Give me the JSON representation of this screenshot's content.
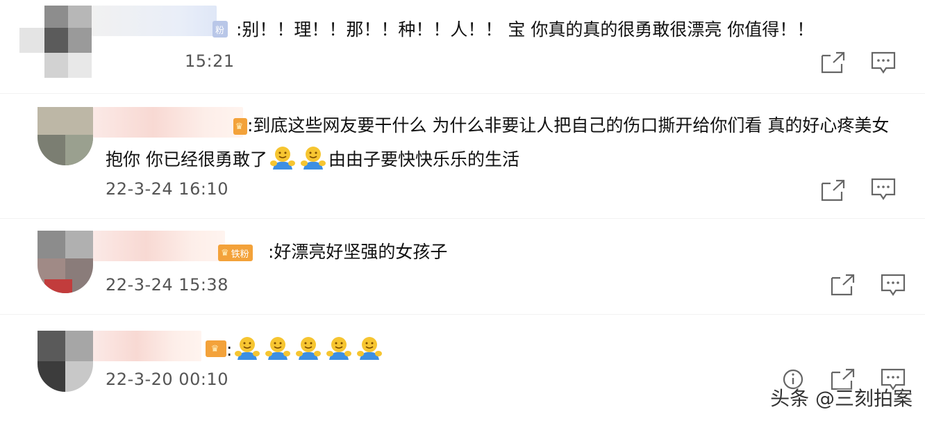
{
  "comments": [
    {
      "badge": "粉",
      "text": ":别！！理！！那！！种！！人！！ 宝 你真的真的很勇敢很漂亮 你值得！！",
      "time": "15:21"
    },
    {
      "badge": "",
      "text": ":到底这些网友要干什么 为什么非要让人把自己的伤口撕开给你们看 真的好心疼美女",
      "text2_a": "抱你 你已经很勇敢了",
      "text2_b": "由由子要快快乐乐的生活",
      "time": "22-3-24 16:10"
    },
    {
      "badge": "铁粉",
      "text": ":好漂亮好坚强的女孩子",
      "time": "22-3-24 15:38"
    },
    {
      "badge": "",
      "text": ":",
      "time": "22-3-20 00:10"
    }
  ],
  "icons": {
    "share": "share-icon",
    "comment": "comment-icon",
    "info": "info-icon",
    "emoji": "hug-emoji"
  },
  "watermark": "头条 @三刻拍案",
  "colors": {
    "badge_gold": "#f3a23a",
    "badge_gray": "#b9c7e8",
    "text": "#111111",
    "meta": "#555555"
  }
}
